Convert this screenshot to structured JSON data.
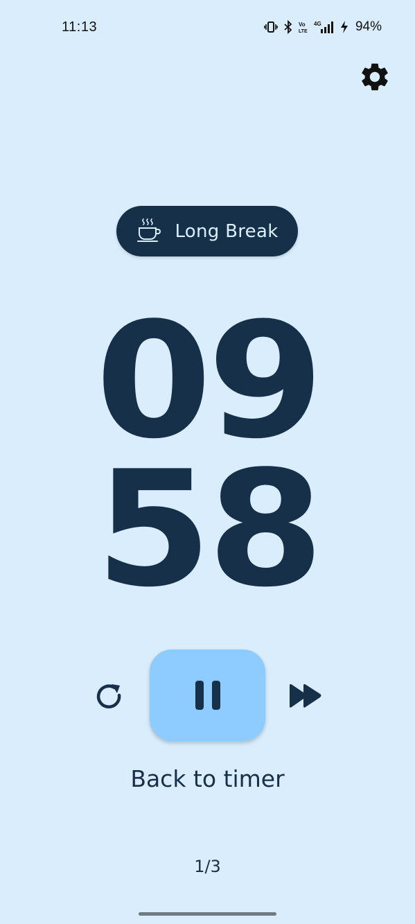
{
  "status_bar": {
    "time": "11:13",
    "battery": "94%",
    "icons": [
      "vibrate-icon",
      "bluetooth-icon",
      "volte-icon",
      "signal-4g-icon",
      "charging-icon"
    ]
  },
  "header": {
    "settings_icon": "gear-icon"
  },
  "mode": {
    "label": "Long Break",
    "icon": "coffee-cup-icon"
  },
  "timer": {
    "minutes": "09",
    "seconds": "58"
  },
  "controls": {
    "reset_icon": "reset-icon",
    "pause_icon": "pause-icon",
    "skip_icon": "fast-forward-icon"
  },
  "back_link": "Back to timer",
  "page_indicator": "1/3",
  "colors": {
    "background": "#d9edfc",
    "primary_dark": "#17304a",
    "pause_button": "#8ecbff"
  }
}
